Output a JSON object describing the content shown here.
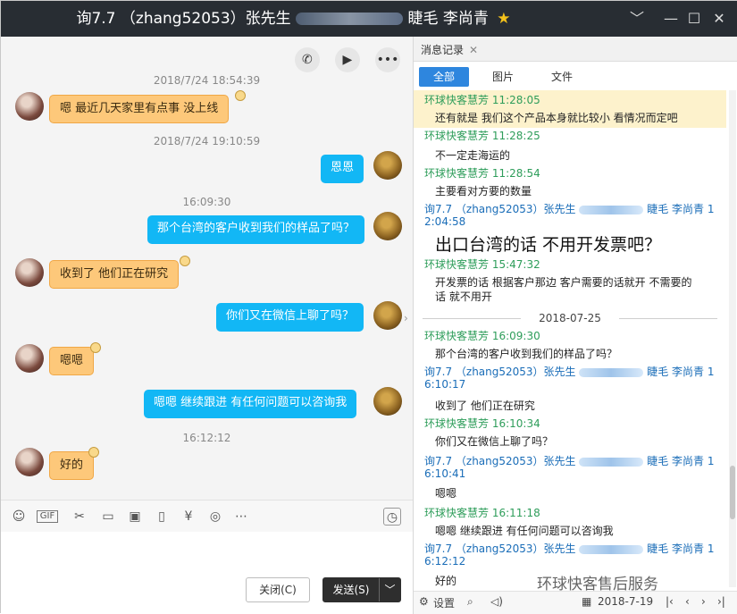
{
  "title": {
    "prefix": "询7.7 （zhang52053）张先生",
    "suffix": "睫毛 李尚青"
  },
  "window": {
    "minimize": "﹀",
    "restore": "—",
    "maximize": "☐",
    "close": "✕"
  },
  "chat": {
    "messages": [
      {
        "type": "time",
        "text": "2018/7/24 18:54:39"
      },
      {
        "type": "in",
        "text": "嗯   最近几天家里有点事  没上线"
      },
      {
        "type": "time",
        "text": "2018/7/24 19:10:59"
      },
      {
        "type": "out",
        "text": "恩恩"
      },
      {
        "type": "time",
        "text": "16:09:30"
      },
      {
        "type": "out",
        "text": "那个台湾的客户收到我们的样品了吗？"
      },
      {
        "type": "in",
        "text": "收到了   他们正在研究"
      },
      {
        "type": "out",
        "text": "你们又在微信上聊了吗？"
      },
      {
        "type": "in",
        "text": "嗯嗯"
      },
      {
        "type": "out",
        "text": "嗯嗯 继续跟进 有任何问题可以咨询我"
      },
      {
        "type": "time",
        "text": "16:12:12"
      },
      {
        "type": "in",
        "text": "好的"
      }
    ]
  },
  "buttons": {
    "close": "关闭(C)",
    "send": "发送(S)",
    "send_arrow": "﹀"
  },
  "history": {
    "tab": "消息记录",
    "tab_close": "✕",
    "filters": [
      "全部",
      "图片",
      "文件"
    ],
    "lines": [
      {
        "cls": "g",
        "text": "环球快客慧芳 11:28:05"
      },
      {
        "cls": "m",
        "text": "还有就是 我们这个产品本身就比较小  看情况而定吧"
      },
      {
        "cls": "g",
        "text": "环球快客慧芳 11:28:25"
      },
      {
        "cls": "m",
        "text": "不一定走海运的"
      },
      {
        "cls": "g",
        "text": "环球快客慧芳 11:28:54"
      },
      {
        "cls": "m",
        "text": "主要看对方要的数量"
      },
      {
        "cls": "b",
        "text": "询7.7 （zhang52053）张先生",
        "tail": "睫毛 李尚青 1"
      },
      {
        "cls": "b",
        "text": "2:04:58"
      },
      {
        "cls": "big",
        "text": "出口台湾的话 不用开发票吧？"
      },
      {
        "cls": "g",
        "text": "环球快客慧芳 15:47:32"
      },
      {
        "cls": "m",
        "text": "开发票的话 根据客户那边 客户需要的话就开 不需要的"
      },
      {
        "cls": "m",
        "text": "话 就不用开"
      },
      {
        "cls": "date",
        "text": "2018-07-25"
      },
      {
        "cls": "g",
        "text": "环球快客慧芳 16:09:30"
      },
      {
        "cls": "m",
        "text": "那个台湾的客户收到我们的样品了吗？"
      },
      {
        "cls": "b",
        "text": "询7.7 （zhang52053）张先生",
        "tail": "睫毛 李尚青 1"
      },
      {
        "cls": "b",
        "text": "6:10:17"
      },
      {
        "cls": "m",
        "text": "收到了   他们正在研究"
      },
      {
        "cls": "g",
        "text": "环球快客慧芳 16:10:34"
      },
      {
        "cls": "m",
        "text": "你们又在微信上聊了吗？"
      },
      {
        "cls": "b",
        "text": "询7.7 （zhang52053）张先生",
        "tail": "睫毛 李尚青 1"
      },
      {
        "cls": "b",
        "text": "6:10:41"
      },
      {
        "cls": "m",
        "text": "嗯嗯"
      },
      {
        "cls": "g",
        "text": "环球快客慧芳 16:11:18"
      },
      {
        "cls": "m",
        "text": "嗯嗯 继续跟进 有任何问题可以咨询我"
      },
      {
        "cls": "b",
        "text": "询7.7 （zhang52053）张先生",
        "tail": "睫毛 李尚青 1"
      },
      {
        "cls": "b",
        "text": "6:12:12"
      },
      {
        "cls": "m",
        "text": "好的"
      }
    ],
    "footer": {
      "settings": "设置",
      "date": "2018-7-19"
    }
  },
  "watermark": "环球快客售后服务",
  "colors": {
    "titlebar": "#282d33",
    "bubble_in": "#fdc87a",
    "bubble_out": "#12b7f5",
    "accent": "#2e86de"
  }
}
